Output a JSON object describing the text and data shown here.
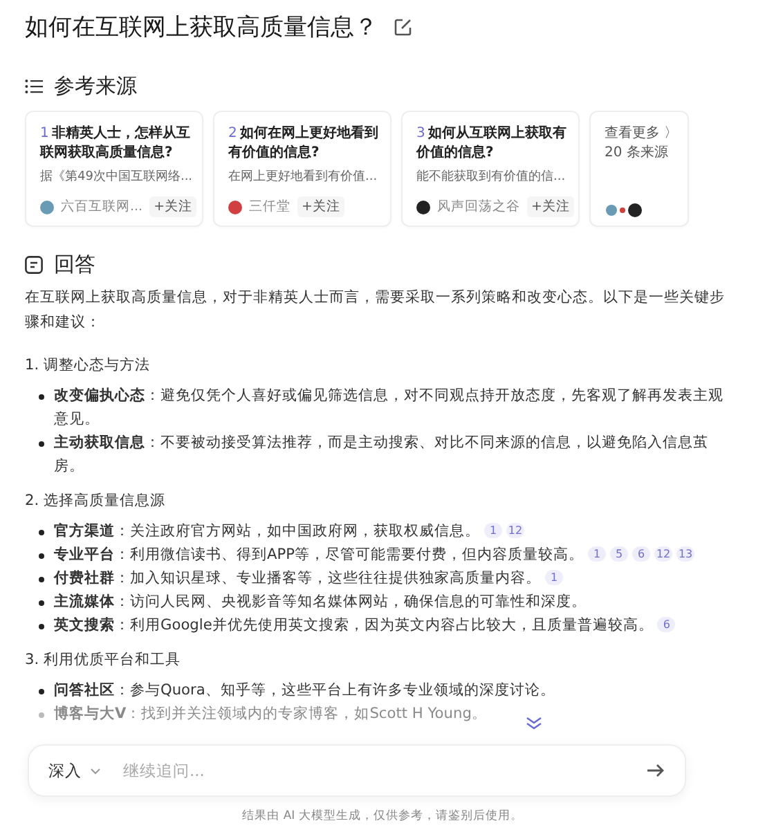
{
  "title": "如何在互联网上获取高质量信息？",
  "sources": {
    "heading": "参考来源",
    "items": [
      {
        "number": "1",
        "title": "非精英人士，怎样从互联网获取高质量信息?",
        "snippet": "据《第49次中国互联网络...",
        "author": "六百互联网...",
        "follow": "+关注"
      },
      {
        "number": "2",
        "title": "如何在网上更好地看到有价值的信息?",
        "snippet": "在网上更好地看到有价值...",
        "author": "三仟堂",
        "follow": "+关注"
      },
      {
        "number": "3",
        "title": "如何从互联网上获取有价值的信息?",
        "snippet": "能不能获取到有价值的信...",
        "author": "风声回荡之谷",
        "follow": "+关注"
      }
    ],
    "more": {
      "label": "查看更多 〉",
      "count": "20 条来源"
    }
  },
  "answer": {
    "heading": "回答",
    "intro": "在互联网上获取高质量信息，对于非精英人士而言，需要采取一系列策略和改变心态。以下是一些关键步骤和建议：",
    "sections": [
      {
        "heading": "1. 调整心态与方法",
        "items": [
          {
            "term": "改变偏执心态",
            "text": "：避免仅凭个人喜好或偏见筛选信息，对不同观点持开放态度，先客观了解再发表主观意见。",
            "faded": false
          },
          {
            "term": "主动获取信息",
            "text": "：不要被动接受算法推荐，而是主动搜索、对比不同来源的信息，以避免陷入信息茧房。",
            "faded": false
          }
        ]
      },
      {
        "heading": "2. 选择高质量信息源",
        "items": [
          {
            "term": "官方渠道",
            "text": "：关注政府官方网站，如中国政府网，获取权威信息。",
            "citations": [
              "1",
              "12"
            ],
            "faded": false
          },
          {
            "term": "专业平台",
            "text": "：利用微信读书、得到APP等，尽管可能需要付费，但内容质量较高。",
            "citations": [
              "1",
              "5",
              "6",
              "12",
              "13"
            ],
            "faded": false
          },
          {
            "term": "付费社群",
            "text": "：加入知识星球、专业播客等，这些往往提供独家高质量内容。",
            "citations": [
              "1"
            ],
            "faded": false
          },
          {
            "term": "主流媒体",
            "text": "：访问人民网、央视影音等知名媒体网站，确保信息的可靠性和深度。",
            "faded": false
          },
          {
            "term": "英文搜索",
            "text": "：利用Google并优先使用英文搜索，因为英文内容占比较大，且质量普遍较高。",
            "citations": [
              "6"
            ],
            "faded": false
          }
        ]
      },
      {
        "heading": "3. 利用优质平台和工具",
        "items": [
          {
            "term": "问答社区",
            "text": "：参与Quora、知乎等，这些平台上有许多专业领域的深度讨论。",
            "faded": false
          },
          {
            "term": "博客与大V",
            "text": "：找到并关注领域内的专家博客，如Scott H Young。",
            "faded": true
          }
        ]
      }
    ]
  },
  "composer": {
    "mode": "深入",
    "placeholder": "继续追问..."
  },
  "footer": "结果由 AI 大模型生成，仅供参考，请鉴别后使用。"
}
